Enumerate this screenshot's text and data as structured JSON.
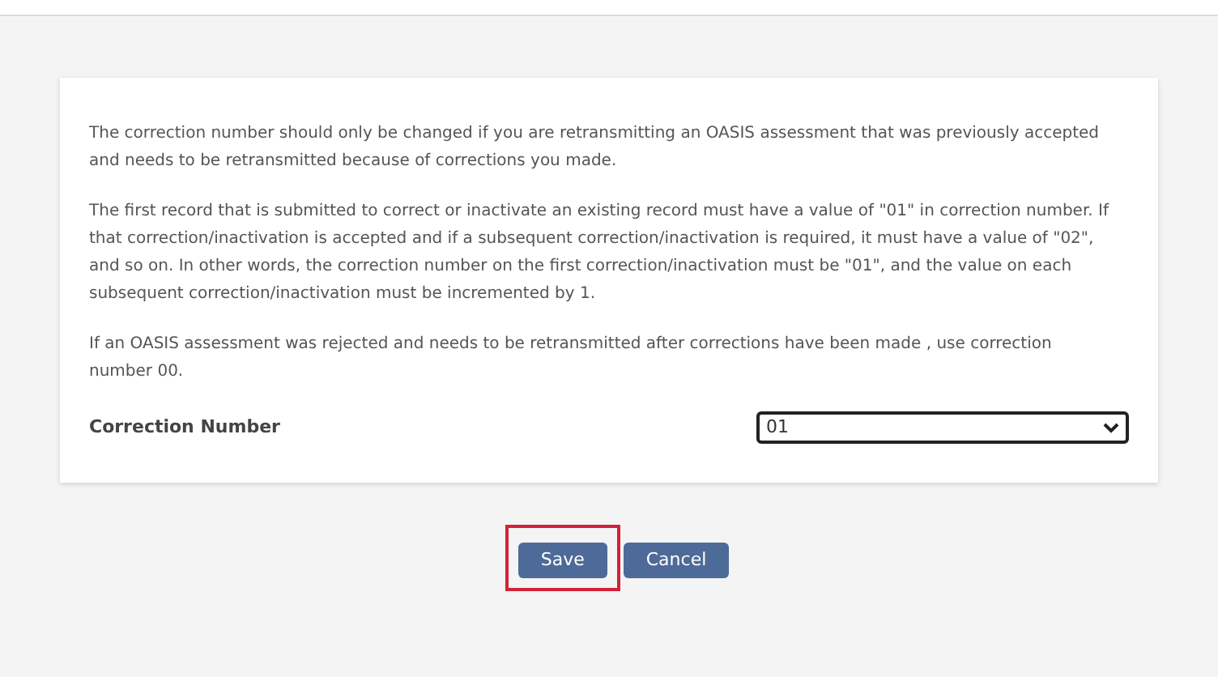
{
  "paragraphs": [
    "The correction number should only be changed if you are retransmitting an OASIS assessment that was previously accepted and needs to be retransmitted because of corrections you made.",
    "The first record that is submitted to correct or inactivate an existing record must have a value of \"01\" in correction number. If that correction/inactivation is accepted and if a subsequent correction/inactivation is required, it must have a value of \"02\", and so on. In other words, the correction number on the first correction/inactivation must be \"01\", and the value on each subsequent correction/inactivation must be incremented by 1.",
    "If an OASIS assessment was rejected and needs to be retransmitted after corrections have been made , use correction number 00."
  ],
  "field": {
    "label": "Correction Number",
    "value": "01"
  },
  "buttons": [
    {
      "label": "Save",
      "focused": true
    },
    {
      "label": "Cancel",
      "focused": false
    }
  ]
}
